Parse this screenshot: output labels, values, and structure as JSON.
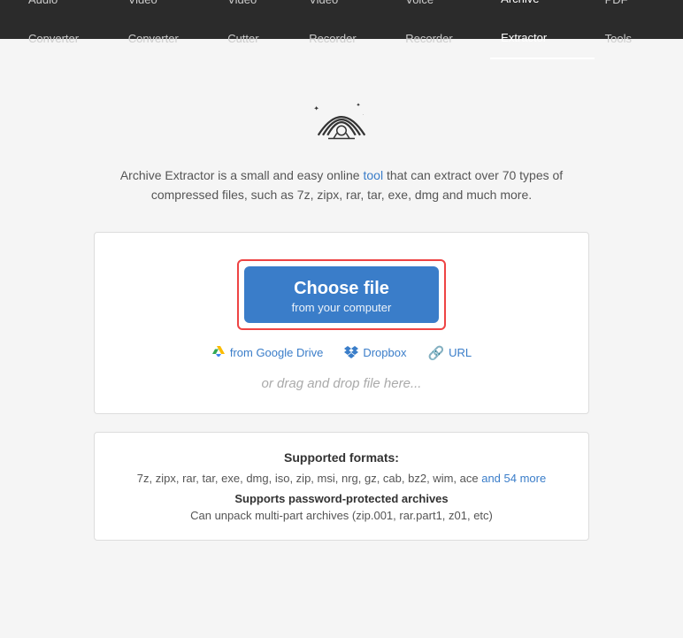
{
  "nav": {
    "items": [
      {
        "label": "Audio Converter",
        "active": false
      },
      {
        "label": "Video Converter",
        "active": false
      },
      {
        "label": "Video Cutter",
        "active": false
      },
      {
        "label": "Video Recorder",
        "active": false
      },
      {
        "label": "Voice Recorder",
        "active": false
      },
      {
        "label": "Archive Extractor",
        "active": true
      },
      {
        "label": "PDF Tools",
        "active": false
      }
    ]
  },
  "hero": {
    "description_part1": "Archive Extractor is a small and easy online tool that can extract over 70 types of",
    "description_part2": "compressed files, such as 7z, zipx, rar, tar, exe, dmg and much more.",
    "tool_link": "tool"
  },
  "upload": {
    "choose_file_label": "Choose file",
    "choose_file_sub": "from your computer",
    "google_drive_label": "from Google Drive",
    "dropbox_label": "Dropbox",
    "url_label": "URL",
    "drag_drop_label": "or drag and drop file here..."
  },
  "supported": {
    "title": "Supported formats:",
    "formats": "7z, zipx, rar, tar, exe, dmg, iso, zip, msi, nrg, gz, cab, bz2, wim, ace",
    "more_label": "and 54 more",
    "feature1": "Supports password-protected archives",
    "feature2": "Can unpack multi-part archives (zip.001, rar.part1, z01, etc)"
  }
}
